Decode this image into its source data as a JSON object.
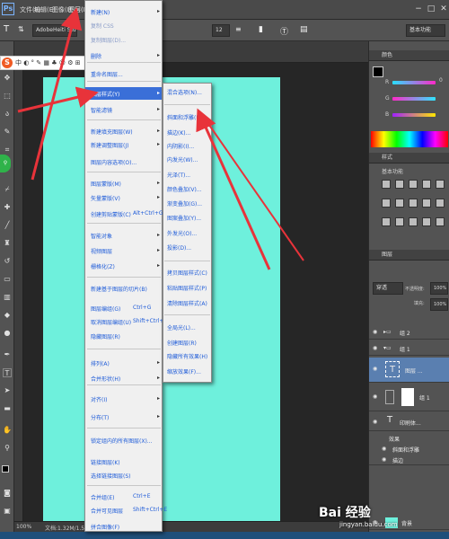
{
  "app": {
    "logo": "Ps"
  },
  "menubar": {
    "items": [
      "文件(F)",
      "编辑(E)",
      "图像(I)",
      "图层(L)"
    ],
    "window_controls": [
      "−",
      "□",
      "✕"
    ]
  },
  "optionsbar": {
    "font_value": "AdobeHeiti Std",
    "size_value": "12",
    "workspace": "基本功能"
  },
  "statusbar": {
    "zoom": "100%",
    "doc": "文档:1.32M/1.55M"
  },
  "watermark": {
    "logo": "Bai 经验",
    "url": "jingyan.baidu.com"
  },
  "layer_menu": {
    "items": [
      {
        "label": "新建(N)",
        "arrow": true
      },
      {
        "label": "复制 CSS",
        "disabled": true
      },
      {
        "label": "复制图层(D)...",
        "disabled": true
      },
      {
        "label": "删除",
        "arrow": true
      },
      {
        "label": "重命名图层..."
      },
      {
        "label": "图层样式(Y)",
        "arrow": true,
        "highlighted": true
      },
      {
        "label": "智能滤镜",
        "arrow": true
      },
      {
        "label": "新建填充图层(W)",
        "arrow": true
      },
      {
        "label": "新建调整图层(J)",
        "arrow": true
      },
      {
        "label": "图层内容选项(O)..."
      },
      {
        "label": "图层蒙版(M)",
        "arrow": true
      },
      {
        "label": "矢量蒙版(V)",
        "arrow": true
      },
      {
        "label": "创建剪贴蒙版(C)",
        "shortcut": "Alt+Ctrl+G"
      },
      {
        "label": "智能对象",
        "arrow": true
      },
      {
        "label": "视频图层",
        "arrow": true
      },
      {
        "label": "栅格化(Z)",
        "arrow": true
      },
      {
        "label": "新建基于图层的切片(B)"
      },
      {
        "label": "图层编组(G)",
        "shortcut": "Ctrl+G"
      },
      {
        "label": "取消图层编组(U)",
        "shortcut": "Shift+Ctrl+G"
      },
      {
        "label": "隐藏图层(R)"
      },
      {
        "label": "排列(A)",
        "arrow": true
      },
      {
        "label": "合并形状(H)",
        "arrow": true
      },
      {
        "label": "对齐(I)",
        "arrow": true
      },
      {
        "label": "分布(T)",
        "arrow": true
      },
      {
        "label": "锁定组内的所有图层(X)..."
      },
      {
        "label": "链接图层(K)"
      },
      {
        "label": "选择链接图层(S)"
      },
      {
        "label": "合并组(E)",
        "shortcut": "Ctrl+E"
      },
      {
        "label": "合并可见图层",
        "shortcut": "Shift+Ctrl+E"
      },
      {
        "label": "拼合图像(F)"
      }
    ]
  },
  "style_submenu": {
    "items": [
      {
        "label": "混合选项(N)..."
      },
      {
        "label": "斜面和浮雕(B)..."
      },
      {
        "label": "描边(K)..."
      },
      {
        "label": "内阴影(I)..."
      },
      {
        "label": "内发光(W)..."
      },
      {
        "label": "光泽(T)..."
      },
      {
        "label": "颜色叠加(V)..."
      },
      {
        "label": "渐变叠加(G)..."
      },
      {
        "label": "图案叠加(Y)..."
      },
      {
        "label": "外发光(O)..."
      },
      {
        "label": "投影(D)..."
      },
      {
        "label": "拷贝图层样式(C)"
      },
      {
        "label": "粘贴图层样式(P)"
      },
      {
        "label": "清除图层样式(A)"
      },
      {
        "label": "全局光(L)..."
      },
      {
        "label": "创建图层(R)"
      },
      {
        "label": "隐藏所有效果(H)"
      },
      {
        "label": "缩放效果(F)..."
      }
    ]
  },
  "right_panels": {
    "color_tab": "颜色",
    "color_sliders": [
      {
        "label": "R",
        "value": "0",
        "color": "#ff28c8"
      },
      {
        "label": "G",
        "value": "",
        "color": "#2ee6ff"
      },
      {
        "label": "B",
        "value": "",
        "color": "#ffe600"
      }
    ],
    "style_tab": "样式",
    "styles_label": "基本功能",
    "layers_tab": "图层",
    "blend_mode": "穿透",
    "opacity_label": "不透明度:",
    "opacity_value": "100%",
    "fill_label": "填充:",
    "fill_value": "100%",
    "layer_items": [
      {
        "name": "组 2",
        "type": "group"
      },
      {
        "name": "组 1",
        "type": "group"
      },
      {
        "name": "图层 ...",
        "type": "text",
        "selected": true
      },
      {
        "name": "组 1",
        "type": "mask"
      },
      {
        "name": "印刷体...",
        "type": "text"
      },
      {
        "name": "效果",
        "type": "fx"
      },
      {
        "name": "斜面和浮雕",
        "type": "fx-item"
      },
      {
        "name": "描边",
        "type": "fx-item"
      },
      {
        "name": "背景",
        "type": "bg"
      }
    ]
  },
  "colors": {
    "canvas": "#6ef0dc",
    "highlight": "#3a6fd8",
    "arrow": "#e8333a"
  }
}
